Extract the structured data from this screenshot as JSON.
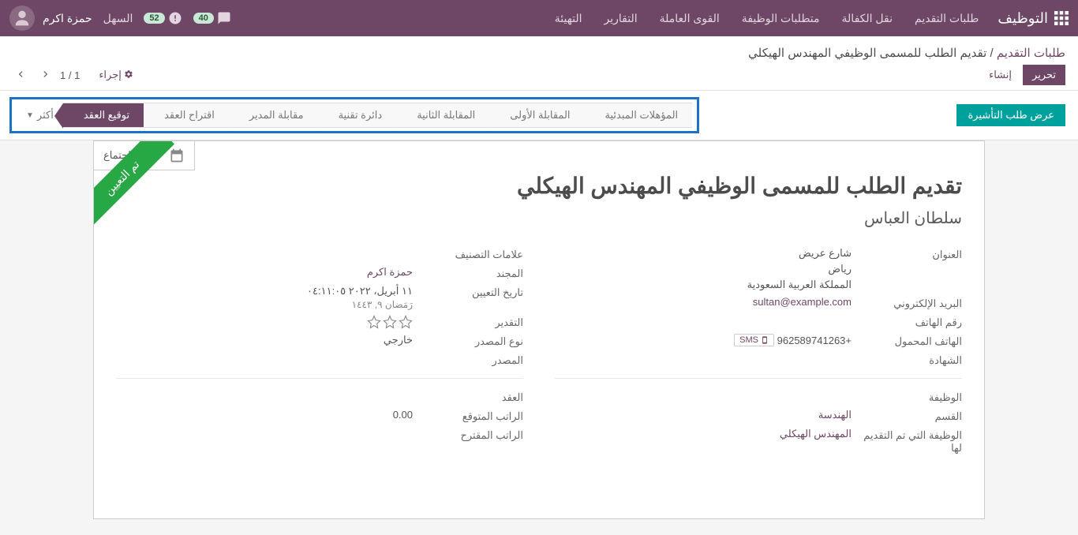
{
  "navbar": {
    "title": "التوظيف",
    "menu": [
      "طلبات التقديم",
      "نقل الكفالة",
      "متطلبات الوظيفة",
      "القوى العاملة",
      "التقارير",
      "التهيئة"
    ],
    "badge1": "40",
    "badge2": "52",
    "easy": "السهل",
    "user": "حمزة اكرم"
  },
  "breadcrumb": {
    "root": "طلبات التقديم",
    "sep": " / ",
    "current": "تقديم الطلب للمسمى الوظيفي المهندس الهيكلي",
    "edit": "تحرير",
    "create": "إنشاء",
    "action": "إجراء",
    "pager": "1 / 1"
  },
  "status": {
    "visa_btn": "عرض طلب التأشيرة",
    "stages": [
      "المؤهلات المبدئية",
      "المقابلة الأولى",
      "المقابلة الثانية",
      "دائرة تقنية",
      "مقابلة المدير",
      "اقتراح العقد"
    ],
    "active_stage": "توقيع العقد",
    "more": "أكثر"
  },
  "sheet": {
    "no_meeting": "لا يوجد اجتماع",
    "ribbon": "تم التعيين",
    "title": "تقديم الطلب للمسمى الوظيفي المهندس الهيكلي",
    "subtitle": "سلطان العباس"
  },
  "left": {
    "address_label": "العنوان",
    "street": "شارع عريض",
    "city": "رياض",
    "country": "المملكة العربية السعودية",
    "email_label": "البريد الإلكتروني",
    "email": "sultan@example.com",
    "phone_label": "رقم الهاتف",
    "mobile_label": "الهاتف المحمول",
    "mobile": "+962589741263",
    "sms": "SMS",
    "degree_label": "الشهادة",
    "job_label": "الوظيفة",
    "dept_label": "القسم",
    "dept": "الهندسة",
    "applied_job_label": "الوظيفة التي تم التقديم لها",
    "applied_job": "المهندس الهيكلي"
  },
  "right": {
    "tags_label": "علامات التصنيف",
    "recruiter_label": "المجند",
    "recruiter": "حمزة اكرم",
    "hire_date_label": "تاريخ التعيين",
    "hire_date": "١١ أبريل، ٢٠٢٢ ٠٤:١١:٠٥",
    "hijri": "رَمَضان ٩, ١٤٤٣",
    "rating_label": "التقدير",
    "source_type_label": "نوع المصدر",
    "source_type": "خارجي",
    "source_label": "المصدر",
    "contract_label": "العقد",
    "expected_salary_label": "الراتب المتوقع",
    "expected_salary": "0.00",
    "proposed_salary_label": "الراتب المقترح"
  }
}
